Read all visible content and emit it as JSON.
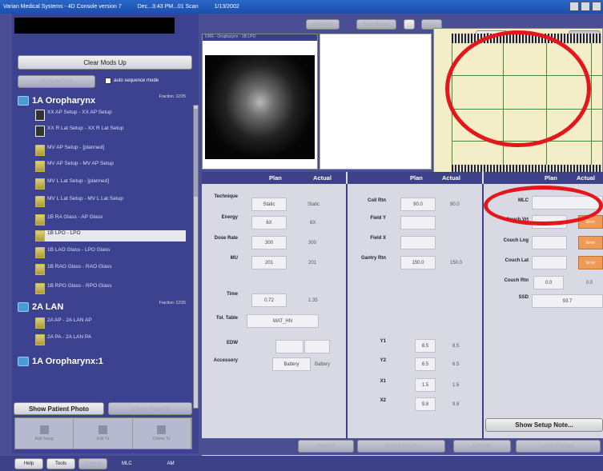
{
  "window": {
    "title": "Varian Medical Systems - 4D Console version 7",
    "title_extra": "Dec...3:43 PM...01 Scan",
    "title_extra2": "1/13/2002"
  },
  "toolbar": {
    "buttons": [
      "Re-Patch",
      "Save Images"
    ]
  },
  "left_panel": {
    "clear_mods_label": "Clear Mods Up",
    "duplicate_label": "Duplicate Field",
    "auto_sequence_label": "auto sequence mode",
    "groups": [
      {
        "name": "1A Oropharynx",
        "meta": "Fraction: 12/35"
      },
      {
        "name": "2A LAN",
        "meta": "Fraction: 12/35"
      },
      {
        "name": "1A Oropharynx:1",
        "meta": ""
      }
    ],
    "fields": [
      {
        "label": "XX AP Setup - XX AP Setup",
        "kind": "setup"
      },
      {
        "label": "XX R Lat Setup - XX R Lat Setup",
        "kind": "setup"
      },
      {
        "label": "MV AP Setup - [planned]",
        "kind": "beam"
      },
      {
        "label": "MV AP Setup - MV AP Setup",
        "kind": "beam"
      },
      {
        "label": "MV L Lat Setup - [planned]",
        "kind": "beam"
      },
      {
        "label": "MV L Lat Setup - MV L Lat Setup",
        "kind": "beam"
      },
      {
        "label": "1B RA Glass - AP Glass",
        "kind": "beam"
      },
      {
        "label": "1B LPO - LPO",
        "kind": "beam"
      },
      {
        "label": "1B LAO Glass - LPO Glass",
        "kind": "beam"
      },
      {
        "label": "1B RAO Glass - RAO Glass",
        "kind": "beam"
      },
      {
        "label": "1B RPO Glass - RPO Glass",
        "kind": "beam"
      },
      {
        "label": "2A AP - 2A LAN AP",
        "kind": "beam"
      },
      {
        "label": "2A PA - 2A LAN PA",
        "kind": "beam"
      }
    ],
    "show_photo_label": "Show Patient Photo",
    "close_photo_label": "Close Patient",
    "tools": [
      "Add Setup",
      "Edit Tx",
      "Delete Tx"
    ]
  },
  "image_panel": {
    "caption": "DRR - Oropharynx - 1B LPO"
  },
  "right_tabs": [
    "Ext...",
    "View"
  ],
  "table": {
    "col_plan": "Plan",
    "col_actual": "Actual",
    "left_rows": [
      {
        "label": "Technique",
        "plan": "Static",
        "actual": "Static"
      },
      {
        "label": "Energy",
        "plan": "6X",
        "actual": "6X"
      },
      {
        "label": "Dose Rate",
        "plan": "300",
        "actual": "300"
      },
      {
        "label": "MU",
        "plan": "201",
        "actual": "201"
      },
      {
        "label": "Time",
        "plan": "0.72",
        "actual": "1.35"
      }
    ],
    "tol_label": "Tol. Table",
    "tol_value": "MAT_HN",
    "edw_label": "EDW",
    "accessory_label": "Accessory",
    "accessory_plan": "Battery",
    "accessory_actual": "Battery",
    "mid_rows": [
      {
        "label": "Coll Rtn",
        "plan": "90.0",
        "actual": "90.0"
      },
      {
        "label": "Field Y",
        "plan": "",
        "actual": ""
      },
      {
        "label": "Field X",
        "plan": "",
        "actual": ""
      },
      {
        "label": "Gantry Rtn",
        "plan": "150.0",
        "actual": "150.0"
      }
    ],
    "jaw_rows": [
      {
        "label": "Y1",
        "plan": "8.5",
        "actual": "8.5"
      },
      {
        "label": "Y2",
        "plan": "6.5",
        "actual": "6.5"
      },
      {
        "label": "X1",
        "plan": "1.5",
        "actual": "1.5"
      },
      {
        "label": "X2",
        "plan": "9.8",
        "actual": "9.8"
      }
    ],
    "right_rows": [
      {
        "label": "MLC",
        "plan": "",
        "actual": ""
      },
      {
        "label": "Couch Vrt",
        "plan": "",
        "actual": "Error"
      },
      {
        "label": "Couch Lng",
        "plan": "",
        "actual": "Error"
      },
      {
        "label": "Couch Lat",
        "plan": "",
        "actual": "Error"
      },
      {
        "label": "Couch Rtn",
        "plan": "0.0",
        "actual": "0.0"
      },
      {
        "label": "SSD",
        "plan": "93.7",
        "actual": ""
      }
    ],
    "right_hdr_plan": "Plan",
    "right_hdr_actual": "Actual",
    "show_setup_label": "Show Setup Note..."
  },
  "actions": [
    "Override",
    "Acquire Actuals",
    "Edit Plan",
    "Undo Changes"
  ],
  "status_bar": {
    "buttons": [
      "Help",
      "Tools",
      "Console"
    ],
    "mode": "MLC",
    "indicator": "AM"
  }
}
